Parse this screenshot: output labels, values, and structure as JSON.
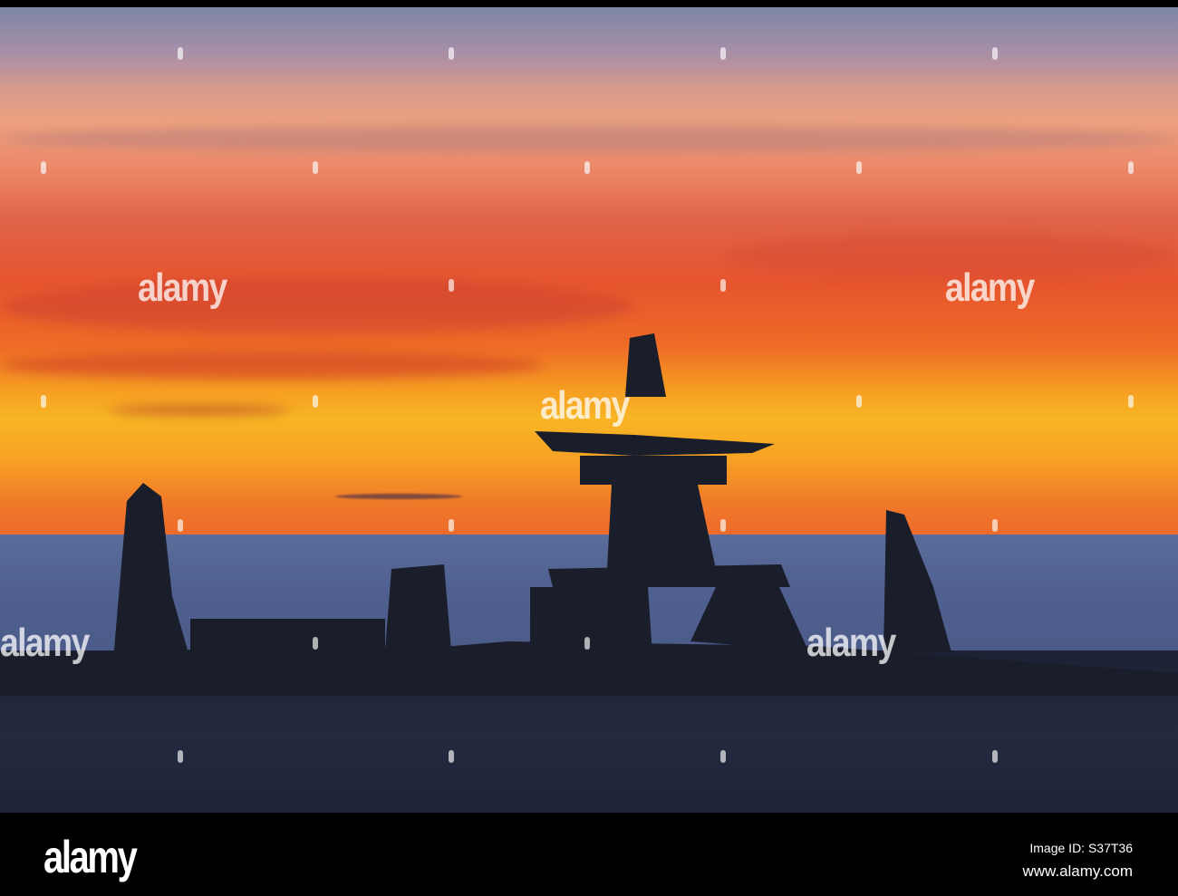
{
  "watermark": {
    "text": "alamy"
  },
  "footer": {
    "logo": "alamy",
    "image_id": "Image ID: S37T36",
    "url": "www.alamy.com"
  },
  "colors": {
    "sky_top": "#7d86a6",
    "sunset_red": "#e6552e",
    "sunset_yellow": "#f8b624",
    "sea": "#4f6090",
    "ground": "#1c2234"
  }
}
